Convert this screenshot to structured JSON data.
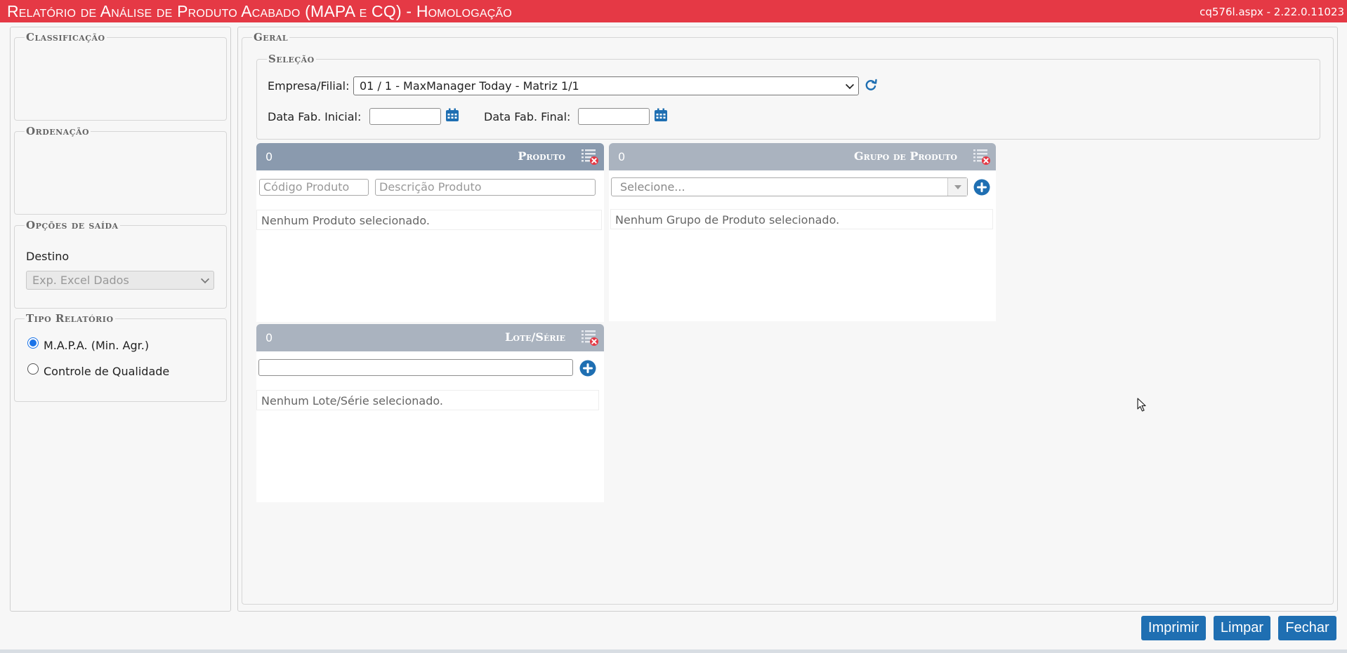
{
  "header": {
    "title": "Relatório de Análise de Produto Acabado (MAPA e CQ)  - Homologação",
    "version": "cq576l.aspx - 2.22.0.11023"
  },
  "left": {
    "classificacao_legend": "Classificação",
    "ordenacao_legend": "Ordenação",
    "opcoes_legend": "Opções de saída",
    "destino_label": "Destino",
    "destino_value": "Exp. Excel Dados",
    "tipo_legend": "Tipo Relatório",
    "tipo_options": [
      {
        "label": "M.A.P.A. (Min. Agr.)",
        "selected": true
      },
      {
        "label": "Controle de Qualidade",
        "selected": false
      }
    ]
  },
  "geral": {
    "legend": "Geral",
    "selecao": {
      "legend": "Seleção",
      "empresa_label": "Empresa/Filial:",
      "empresa_value": "01 / 1 - MaxManager Today - Matriz 1/1",
      "data_inicial_label": "Data Fab. Inicial:",
      "data_final_label": "Data Fab. Final:"
    },
    "produto": {
      "count": "0",
      "title": "Produto",
      "codigo_placeholder": "Código Produto",
      "descricao_placeholder": "Descrição Produto",
      "empty": "Nenhum Produto selecionado."
    },
    "grupo": {
      "count": "0",
      "title": "Grupo de Produto",
      "select_placeholder": "Selecione...",
      "empty": "Nenhum Grupo de Produto selecionado."
    },
    "lote": {
      "count": "0",
      "title": "Lote/Série",
      "empty": "Nenhum Lote/Série selecionado."
    }
  },
  "buttons": {
    "imprimir": "Imprimir",
    "limpar": "Limpar",
    "fechar": "Fechar"
  },
  "colors": {
    "header_bg": "#e53945",
    "panel_active": "#8a9aae",
    "panel_inactive": "#aab3bf",
    "button_bg": "#1f6fb2",
    "icon_blue": "#1f6fb2"
  }
}
